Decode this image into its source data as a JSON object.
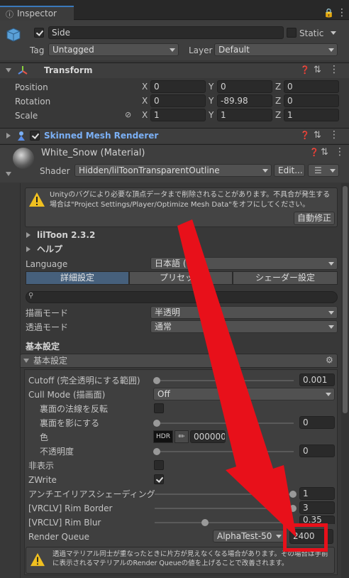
{
  "tab": {
    "title": "Inspector"
  },
  "object": {
    "name": "Side",
    "static_label": "Static",
    "tag_label": "Tag",
    "tag_value": "Untagged",
    "layer_label": "Layer",
    "layer_value": "Default"
  },
  "transform": {
    "title": "Transform",
    "position_label": "Position",
    "rotation_label": "Rotation",
    "scale_label": "Scale",
    "position": [
      "0",
      "0",
      "0"
    ],
    "rotation": [
      "0",
      "-89.98",
      "0"
    ],
    "scale": [
      "1",
      "1",
      "1"
    ],
    "axes": [
      "X",
      "Y",
      "Z"
    ]
  },
  "skinned": {
    "title": "Skinned Mesh Renderer"
  },
  "material": {
    "name": "White_Snow (Material)",
    "shader_label": "Shader",
    "shader_value": "Hidden/lilToonTransparentOutline",
    "edit_label": "Edit..."
  },
  "warning": {
    "text": "Unityのバグにより必要な頂点データまで削除されることがあります。不具合が発生する場合は\"Project Settings/Player/Optimize Mesh Data\"をオフにしてください。",
    "fix_button": "自動修正"
  },
  "liltoon": {
    "version": "lilToon 2.3.2",
    "help": "ヘルプ",
    "language_label": "Language",
    "language_value": "日本語 (日本)",
    "tabs": [
      "詳細設定",
      "プリセット",
      "シェーダー設定"
    ],
    "render_mode_label": "描画モード",
    "render_mode_value": "半透明",
    "transparent_mode_label": "透過モード",
    "transparent_mode_value": "通常",
    "basic_heading": "基本設定",
    "basic_section": "基本設定"
  },
  "props": {
    "cutoff_label": "Cutoff (完全透明にする範囲)",
    "cutoff_value": "0.001",
    "cull_label": "Cull Mode (描画面)",
    "cull_value": "Off",
    "flip_normal_label": "裏面の法線を反転",
    "backface_shadow_label": "裏面を影にする",
    "backface_shadow_value": "0",
    "color_label": "色",
    "hdr_label": "HDR",
    "color_hex": "000000",
    "opacity_label": "不透明度",
    "opacity_value": "0",
    "hide_label": "非表示",
    "zwrite_label": "ZWrite",
    "aa_label": "アンチエイリアスシェーディング",
    "aa_value": "1",
    "rim_border_label": "[VRCLV] Rim Border",
    "rim_border_value": "3",
    "rim_blur_label": "[VRCLV] Rim Blur",
    "rim_blur_value": "0.35",
    "rq_label": "Render Queue",
    "rq_preset": "AlphaTest-50",
    "rq_value": "2400"
  },
  "bottom_warning": {
    "text": "透過マテリアル同士が重なったときに片方が見えなくなる場合があります。その場合は手前に表示されるマテリアルのRender Queueの値を上げることで改善されます。"
  },
  "colors": {
    "accent": "#7bb0f5",
    "highlight": "#e8101a",
    "tab_selected": "#46607c"
  }
}
